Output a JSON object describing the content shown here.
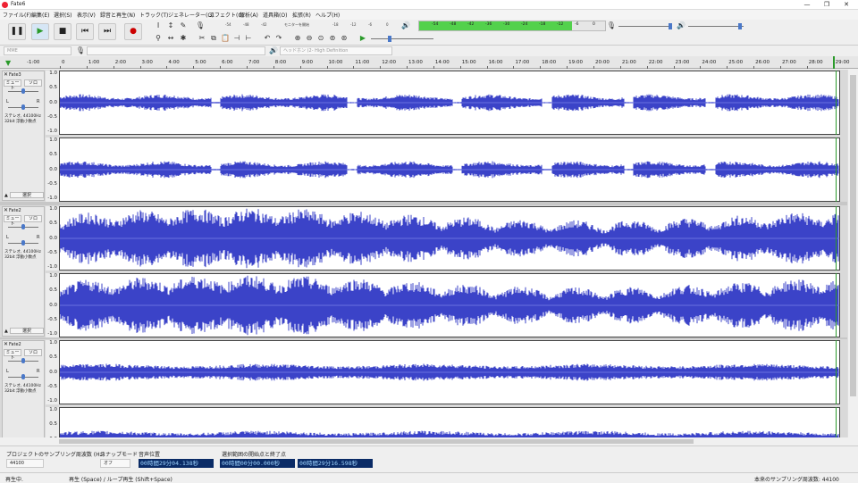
{
  "window": {
    "title": "Fate6",
    "minimize": "—",
    "maximize": "❐",
    "close": "✕"
  },
  "menu": [
    "ファイル(F)",
    "編集(E)",
    "選択(S)",
    "表示(V)",
    "録音と再生(N)",
    "トラック(T)",
    "ジェネレーター(G)",
    "エフェクト(C)",
    "解析(A)",
    "道具箱(O)",
    "拡張(R)",
    "ヘルプ(H)"
  ],
  "meters": {
    "record_ticks": [
      "-54",
      "-48",
      "-42",
      "モニターを開始",
      "-18",
      "-12",
      "-6",
      "0"
    ],
    "play_ticks": [
      "-54",
      "-48",
      "-42",
      "-36",
      "-30",
      "-24",
      "-18",
      "-12",
      "-6",
      "0"
    ],
    "play_level": 0.82
  },
  "devices": {
    "host": "MME",
    "output": "ヘッドホン (2- High Definition"
  },
  "ruler": {
    "start": "-1:00",
    "labels": [
      "0",
      "1:00",
      "2:00",
      "3:00",
      "4:00",
      "5:00",
      "6:00",
      "7:00",
      "8:00",
      "9:00",
      "10:00",
      "11:00",
      "12:00",
      "13:00",
      "14:00",
      "15:00",
      "16:00",
      "17:00",
      "18:00",
      "19:00",
      "20:00",
      "21:00",
      "22:00",
      "23:00",
      "24:00",
      "25:00",
      "26:00",
      "27:00",
      "28:00",
      "29:00"
    ]
  },
  "tracks": [
    {
      "name": "Fate3",
      "mute": "ミュート",
      "solo": "ソロ",
      "info": [
        "ステレオ, 44100Hz",
        "32bit 浮動小数点"
      ],
      "select": "選択",
      "style": "light"
    },
    {
      "name": "Fate2",
      "mute": "ミュート",
      "solo": "ソロ",
      "info": [
        "ステレオ, 44100Hz",
        "32bit 浮動小数点"
      ],
      "select": "選択",
      "style": "loud"
    },
    {
      "name": "Fate2",
      "mute": "ミュート",
      "solo": "ソロ",
      "info": [
        "ステレオ, 44100Hz",
        "32bit 浮動小数点"
      ],
      "select": "選択",
      "style": "band"
    }
  ],
  "scale": {
    "top": "1.0",
    "upper": "0.5",
    "mid": "0.0",
    "lower": "-0.5",
    "bottom": "-1.0"
  },
  "pan": {
    "left": "L",
    "right": "R"
  },
  "selection": {
    "rate_label": "プロジェクトのサンプリング周波数 (Hz)",
    "rate_value": "44100",
    "snap_label": "スナップモード",
    "snap_value": "オフ",
    "pos_label": "音声位置",
    "pos_value": "00時間29分04.138秒",
    "range_label": "選択範囲の開始点と終了点",
    "start_value": "00時間00分00.000秒",
    "end_value": "00時間29分16.598秒"
  },
  "status": {
    "left": "再生中.",
    "middle": "再生 (Space) / ループ再生 (Shift+Space)",
    "right": "本来のサンプリング周波数: 44100"
  },
  "colors": {
    "wave": "#3b43c8",
    "wave_light": "#6a72e0",
    "selection_bg": "#ffffff",
    "meter_green": "#53d14c"
  }
}
